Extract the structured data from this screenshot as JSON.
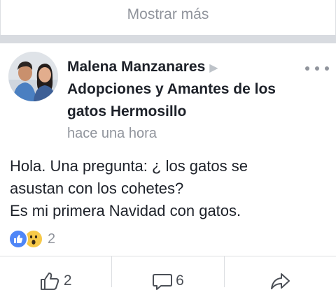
{
  "feed": {
    "show_more_label": "Mostrar más"
  },
  "post": {
    "author": "Malena Manzanares",
    "group_line1": "Adopciones y Amantes de los",
    "group_line2": "gatos Hermosillo",
    "timestamp": "hace una hora",
    "text_line1": "Hola. Una pregunta: ¿ los gatos se",
    "text_line2": "asustan con los cohetes?",
    "text_line3": "Es mi primera Navidad con gatos.",
    "reaction_icons": [
      "like-reaction-icon",
      "wow-reaction-icon"
    ],
    "reaction_count": "2",
    "actions": {
      "like_count": "2",
      "comment_count": "6"
    }
  },
  "colors": {
    "text": "#1d2129",
    "muted": "#90949c",
    "separator": "#d8dbe0",
    "like_blue": "#4f86f7",
    "wow_yellow": "#f7c948"
  }
}
